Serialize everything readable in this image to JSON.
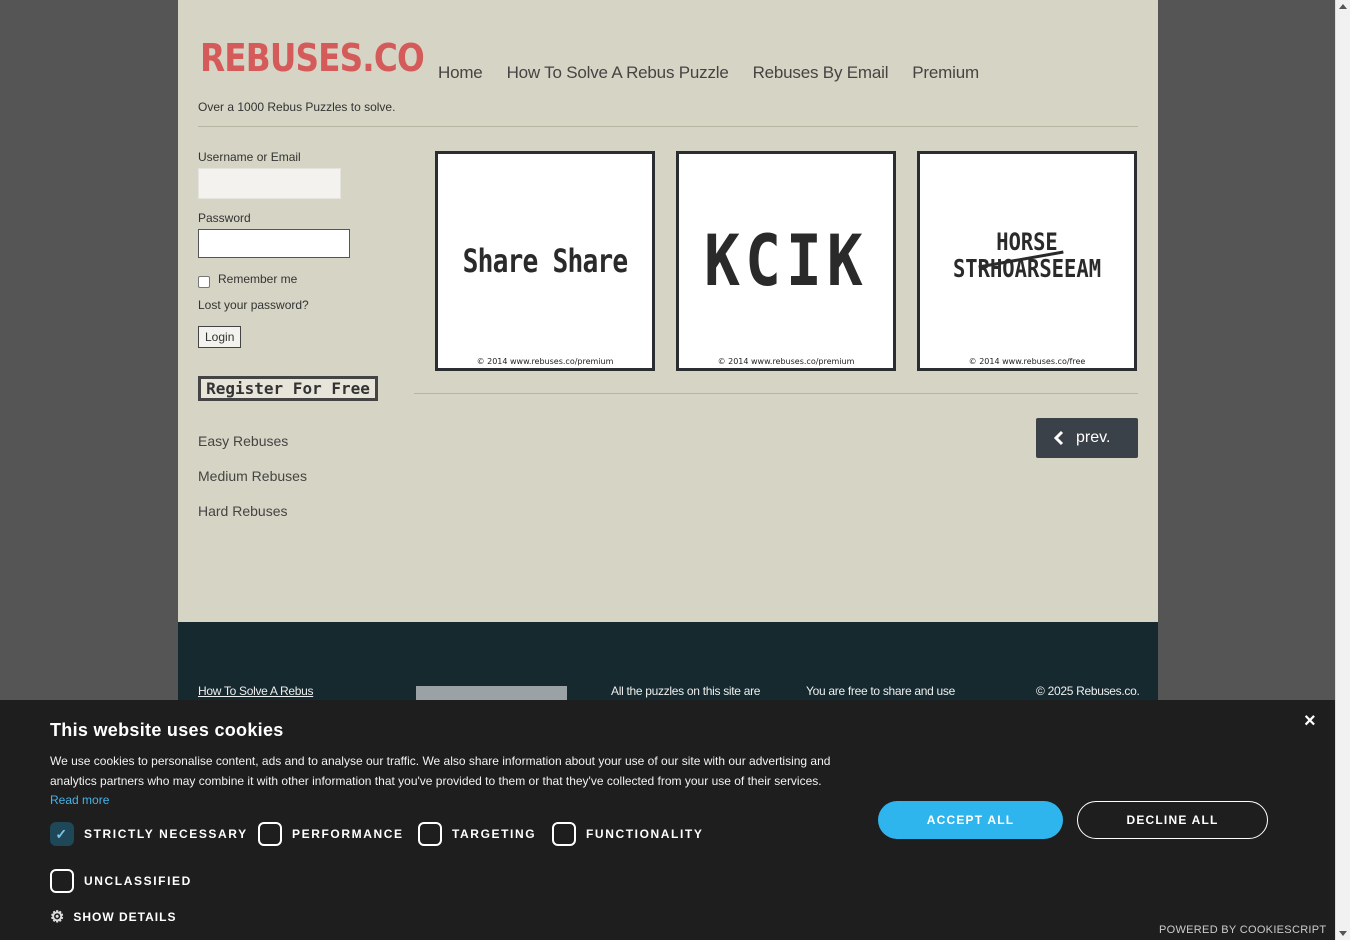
{
  "header": {
    "logo": "REBUSES.CO",
    "tagline": "Over a 1000 Rebus Puzzles to solve.",
    "nav": [
      "Home",
      "How To Solve A Rebus Puzzle",
      "Rebuses By Email",
      "Premium"
    ]
  },
  "login": {
    "username_label": "Username or Email",
    "password_label": "Password",
    "remember_label": "Remember me",
    "lost_password": "Lost your password?",
    "login_button": "Login",
    "register_button": "Register For Free"
  },
  "categories": [
    "Easy Rebuses",
    "Medium Rebuses",
    "Hard Rebuses"
  ],
  "puzzles": [
    {
      "text": "Share Share",
      "copyright": "© 2014 www.rebuses.co/premium"
    },
    {
      "text": "KCIK",
      "copyright": "© 2014 www.rebuses.co/premium"
    },
    {
      "top": "HORSE",
      "bottom": "STRHOARSEEAM",
      "copyright": "© 2014 www.rebuses.co/free"
    }
  ],
  "pagination": {
    "prev_label": "prev."
  },
  "footer": {
    "col1": "How To Solve A Rebus",
    "col2": "All the puzzles on this site are",
    "col3": "You are free to share and use",
    "col4": "© 2025 Rebuses.co."
  },
  "cookie": {
    "title": "This website uses cookies",
    "text": "We use cookies to personalise content, ads and to analyse our traffic. We also share information about your use of our site with our advertising and analytics partners who may combine it with other information that you've provided to them or that they've collected from your use of their services.",
    "read_more": "Read more",
    "options": [
      "STRICTLY NECESSARY",
      "PERFORMANCE",
      "TARGETING",
      "FUNCTIONALITY",
      "UNCLASSIFIED"
    ],
    "show_details": "SHOW DETAILS",
    "accept": "ACCEPT ALL",
    "decline": "DECLINE ALL",
    "powered": "POWERED BY COOKIESCRIPT",
    "close": "×"
  }
}
